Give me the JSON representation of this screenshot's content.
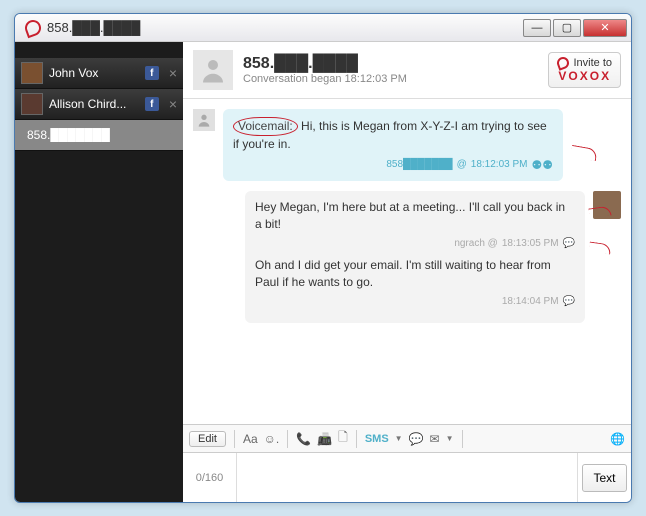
{
  "window": {
    "title": "858.███.████"
  },
  "sidebar": {
    "contacts": [
      {
        "name": "John Vox",
        "has_fb": true
      },
      {
        "name": "Allison Chird...",
        "has_fb": true
      },
      {
        "name": "858.███████",
        "has_fb": false,
        "active": true
      }
    ]
  },
  "header": {
    "number": "858.███.████",
    "began_label": "Conversation began",
    "began_time": "18:12:03 PM",
    "invite_line1": "Invite to",
    "invite_line2": "VOXOX"
  },
  "messages": {
    "incoming": {
      "vm_label": "Voicemail:",
      "text": "Hi, this is Megan from X-Y-Z-I am trying to see if you're in.",
      "meta_from": "858███████",
      "meta_at": "@",
      "meta_time": "18:12:03 PM"
    },
    "outgoing": {
      "block1_text": "Hey Megan, I'm here but at a meeting... I'll call you back in a bit!",
      "block1_from": "ngrach @",
      "block1_time": "18:13:05 PM",
      "block2_text": "Oh and I did get your email. I'm still waiting to hear from Paul if he wants to go.",
      "block2_time": "18:14:04 PM"
    }
  },
  "toolbar": {
    "edit": "Edit",
    "font": "Aa",
    "emoji": "☺.",
    "phone": "📞",
    "fax": "📠",
    "doc": "🗋",
    "sms": "SMS",
    "chat": "💬",
    "mail": "✉",
    "globe": "🌐"
  },
  "compose": {
    "counter": "0/160",
    "send": "Text"
  }
}
